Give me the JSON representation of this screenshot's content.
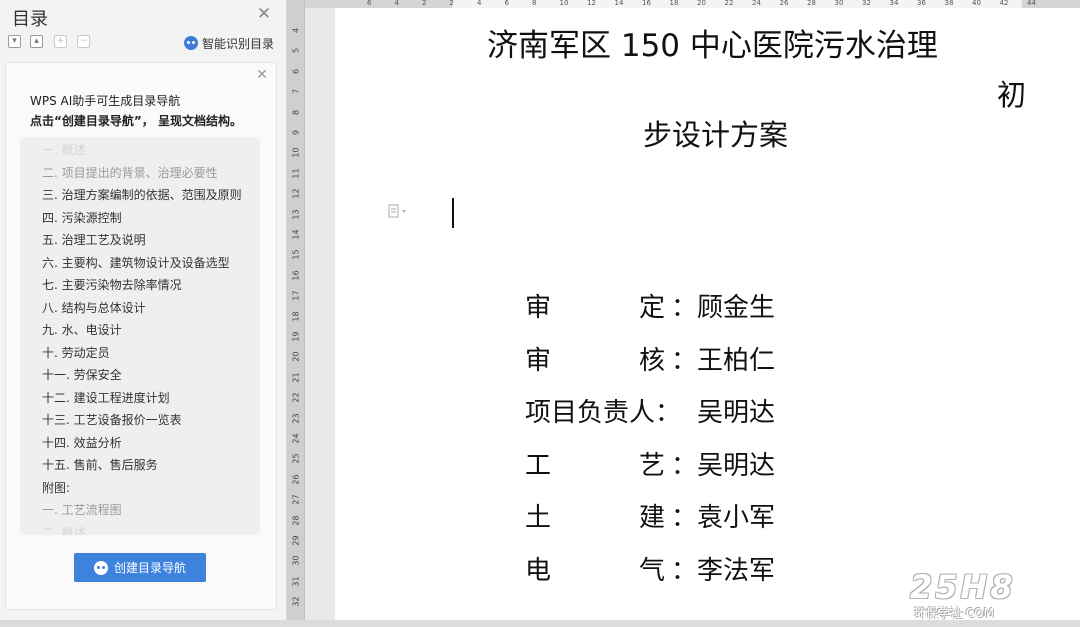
{
  "toc_panel": {
    "title": "目录",
    "smart_detect_label": "智能识别目录",
    "ai_card": {
      "line1": "WPS AI助手可生成目录导航",
      "line2": "点击“创建目录导航”， 呈现文档结构。",
      "create_button_label": "创建目录导航",
      "preview_items": [
        "一. 概述",
        "二. 项目提出的背景、治理必要性",
        "三. 治理方案编制的依据、范围及原则",
        "四. 污染源控制",
        "五. 治理工艺及说明",
        "六. 主要构、建筑物设计及设备选型",
        "七. 主要污染物去除率情况",
        "八. 结构与总体设计",
        "九. 水、电设计",
        "十. 劳动定员",
        "十一. 劳保安全",
        "十二. 建设工程进度计划",
        "十三. 工艺设备报价一览表",
        "十四. 效益分析",
        "十五. 售前、售后服务",
        "附图:",
        "一. 工艺流程图",
        "二. 概述"
      ]
    }
  },
  "ruler": {
    "vertical_ticks": [
      "4",
      "5",
      "6",
      "7",
      "8",
      "9",
      "10",
      "11",
      "12",
      "13",
      "14",
      "15",
      "16",
      "17",
      "18",
      "19",
      "20",
      "21",
      "22",
      "23",
      "24",
      "25",
      "26",
      "27",
      "28",
      "29",
      "30",
      "31",
      "32"
    ],
    "horizontal_ticks": [
      "6",
      "4",
      "2",
      "2",
      "4",
      "6",
      "8",
      "10",
      "12",
      "14",
      "16",
      "18",
      "20",
      "22",
      "24",
      "26",
      "28",
      "30",
      "32",
      "34",
      "36",
      "38",
      "40",
      "42",
      "44"
    ]
  },
  "document": {
    "title_line1": "济南军区 150 中心医院污水治理",
    "title_line_chu": "初",
    "title_line2": "步设计方案",
    "credits": [
      {
        "role": "审定",
        "name": "顾金生",
        "spread": true
      },
      {
        "role": "审核",
        "name": "王柏仁",
        "spread": true
      },
      {
        "role": "项目负责人",
        "name": "吴明达",
        "spread": false
      },
      {
        "role": "工艺",
        "name": "吴明达",
        "spread": true
      },
      {
        "role": "土建",
        "name": "袁小军",
        "spread": true
      },
      {
        "role": "电气",
        "name": "李法军",
        "spread": true
      }
    ],
    "colon": "："
  },
  "watermark": {
    "logo": "25H8",
    "sub": "环保学社·COM"
  }
}
